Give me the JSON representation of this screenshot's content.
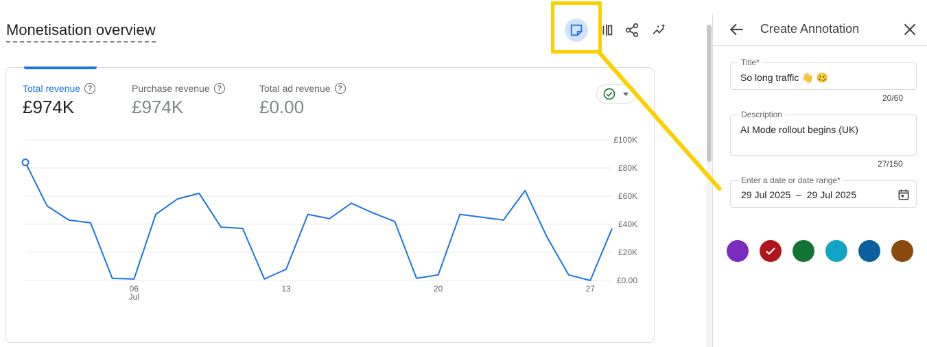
{
  "page": {
    "title": "Monetisation overview"
  },
  "toolbar": {
    "items": [
      {
        "name": "annotation-button",
        "icon": "sticky-note-icon",
        "active": true
      },
      {
        "name": "compare-button",
        "icon": "compare-columns-icon"
      },
      {
        "name": "share-button",
        "icon": "share-icon"
      },
      {
        "name": "insights-button",
        "icon": "insights-sparkle-icon"
      }
    ]
  },
  "metrics": [
    {
      "label": "Total revenue",
      "value": "£974K",
      "active": true
    },
    {
      "label": "Purchase revenue",
      "value": "£974K"
    },
    {
      "label": "Total ad revenue",
      "value": "£0.00"
    }
  ],
  "help_glyph": "?",
  "compare_chip": {
    "icon": "check-circle-icon",
    "dropdown_icon": "caret-down-icon"
  },
  "chart_data": {
    "type": "line",
    "title": "",
    "xlabel": "",
    "ylabel": "",
    "ylim": [
      0,
      100000
    ],
    "y_ticks": [
      "£100K",
      "£80K",
      "£60K",
      "£40K",
      "£20K",
      "£0.00"
    ],
    "x_ticks": [
      {
        "label": "06",
        "sub": "Jul",
        "day": 6
      },
      {
        "label": "13",
        "sub": "",
        "day": 13
      },
      {
        "label": "20",
        "sub": "",
        "day": 20
      },
      {
        "label": "27",
        "sub": "",
        "day": 27
      }
    ],
    "grid": true,
    "y_axis_side": "right",
    "series": [
      {
        "color": "#1a73e8",
        "x": [
          1,
          2,
          3,
          4,
          5,
          6,
          7,
          8,
          9,
          10,
          11,
          12,
          13,
          14,
          15,
          16,
          17,
          18,
          19,
          20,
          21,
          22,
          23,
          24,
          25,
          26,
          27,
          28
        ],
        "values": [
          84000,
          53000,
          43000,
          41000,
          1500,
          1000,
          47000,
          58000,
          62000,
          38000,
          37000,
          1000,
          8000,
          47000,
          44000,
          55000,
          48000,
          42000,
          1500,
          4000,
          47000,
          45000,
          43000,
          64000,
          31000,
          4000,
          0,
          37000
        ]
      }
    ]
  },
  "panel": {
    "title": "Create Annotation",
    "back_icon": "arrow-back-icon",
    "close_icon": "close-icon",
    "title_field": {
      "label": "Title*",
      "value": "So long traffic 👋 🥴",
      "counter": "20/60"
    },
    "description_field": {
      "label": "Description",
      "value": "AI Mode rollout begins (UK)",
      "counter": "27/150"
    },
    "date_field": {
      "label": "Enter a date or date range*",
      "value": "29 Jul 2025  –  29 Jul 2025",
      "icon": "calendar-icon"
    },
    "colors": [
      {
        "name": "purple",
        "hex": "#7b2cbf"
      },
      {
        "name": "red",
        "hex": "#b3141c",
        "selected": true
      },
      {
        "name": "green",
        "hex": "#137333"
      },
      {
        "name": "teal",
        "hex": "#12a4c4"
      },
      {
        "name": "blue",
        "hex": "#0b5f9c"
      },
      {
        "name": "brown",
        "hex": "#8a4a0b"
      }
    ]
  },
  "highlight": {
    "color": "#fcd000"
  }
}
